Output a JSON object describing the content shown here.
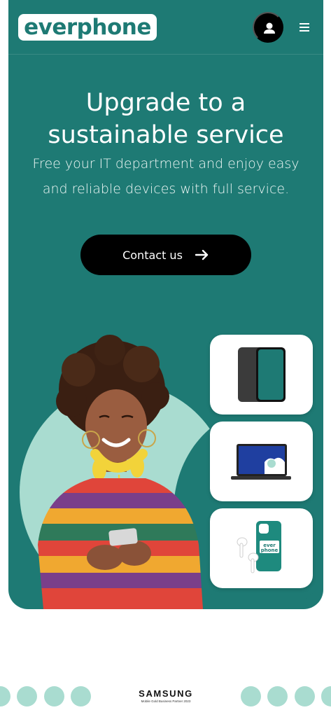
{
  "header": {
    "logo_text": "everphone",
    "account_icon": "user-icon",
    "menu_icon": "hamburger-menu-icon"
  },
  "hero": {
    "title_line1": "Upgrade to a",
    "title_line2": "sustainable service",
    "subtitle_line1": "Free your IT department and enjoy easy",
    "subtitle_line2": "and reliable devices with full service.",
    "cta_label": "Contact us",
    "cta_icon": "arrow-right-icon",
    "image": "woman-with-smartphone-and-headphones",
    "product_cards": [
      {
        "icon": "smartphone-icon"
      },
      {
        "icon": "laptop-icon"
      },
      {
        "icon": "earbuds-and-phone-case-icon",
        "case_text": "ever phone"
      }
    ]
  },
  "partner": {
    "brand": "SAMSUNG",
    "tagline": "Mobile Gold Business Partner 2023"
  },
  "colors": {
    "brand_teal": "#1e7a74",
    "mint": "#a9dcd0",
    "cta_black": "#000000",
    "white": "#ffffff"
  }
}
